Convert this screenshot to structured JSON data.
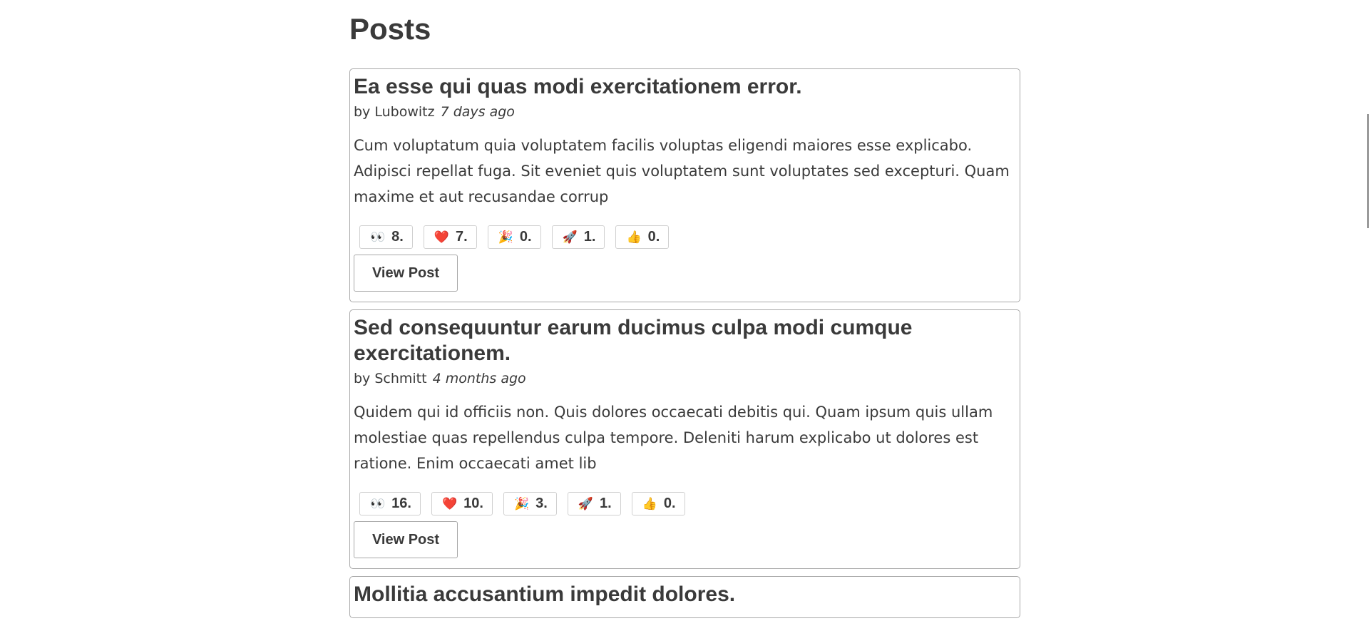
{
  "page": {
    "title": "Posts"
  },
  "posts": [
    {
      "title": "Ea esse qui quas modi exercitationem error.",
      "author": "by Lubowitz",
      "date": "7 days ago",
      "excerpt": "Cum voluptatum quia voluptatem facilis voluptas eligendi maiores esse explicabo. Adipisci repellat fuga. Sit eveniet quis voluptatem sunt voluptates sed excepturi. Quam maxime et aut recusandae corrup",
      "reactions": [
        {
          "emoji": "👀",
          "count": "8."
        },
        {
          "emoji": "❤️",
          "count": "7."
        },
        {
          "emoji": "🎉",
          "count": "0."
        },
        {
          "emoji": "🚀",
          "count": "1."
        },
        {
          "emoji": "👍",
          "count": "0."
        }
      ],
      "button_label": "View Post"
    },
    {
      "title": "Sed consequuntur earum ducimus culpa modi cumque exercitationem.",
      "author": "by Schmitt",
      "date": "4 months ago",
      "excerpt": "Quidem qui id officiis non. Quis dolores occaecati debitis qui. Quam ipsum quis ullam molestiae quas repellendus culpa tempore. Deleniti harum explicabo ut dolores est ratione. Enim occaecati amet lib",
      "reactions": [
        {
          "emoji": "👀",
          "count": "16."
        },
        {
          "emoji": "❤️",
          "count": "10."
        },
        {
          "emoji": "🎉",
          "count": "3."
        },
        {
          "emoji": "🚀",
          "count": "1."
        },
        {
          "emoji": "👍",
          "count": "0."
        }
      ],
      "button_label": "View Post"
    },
    {
      "title": "Mollitia accusantium impedit dolores."
    }
  ]
}
